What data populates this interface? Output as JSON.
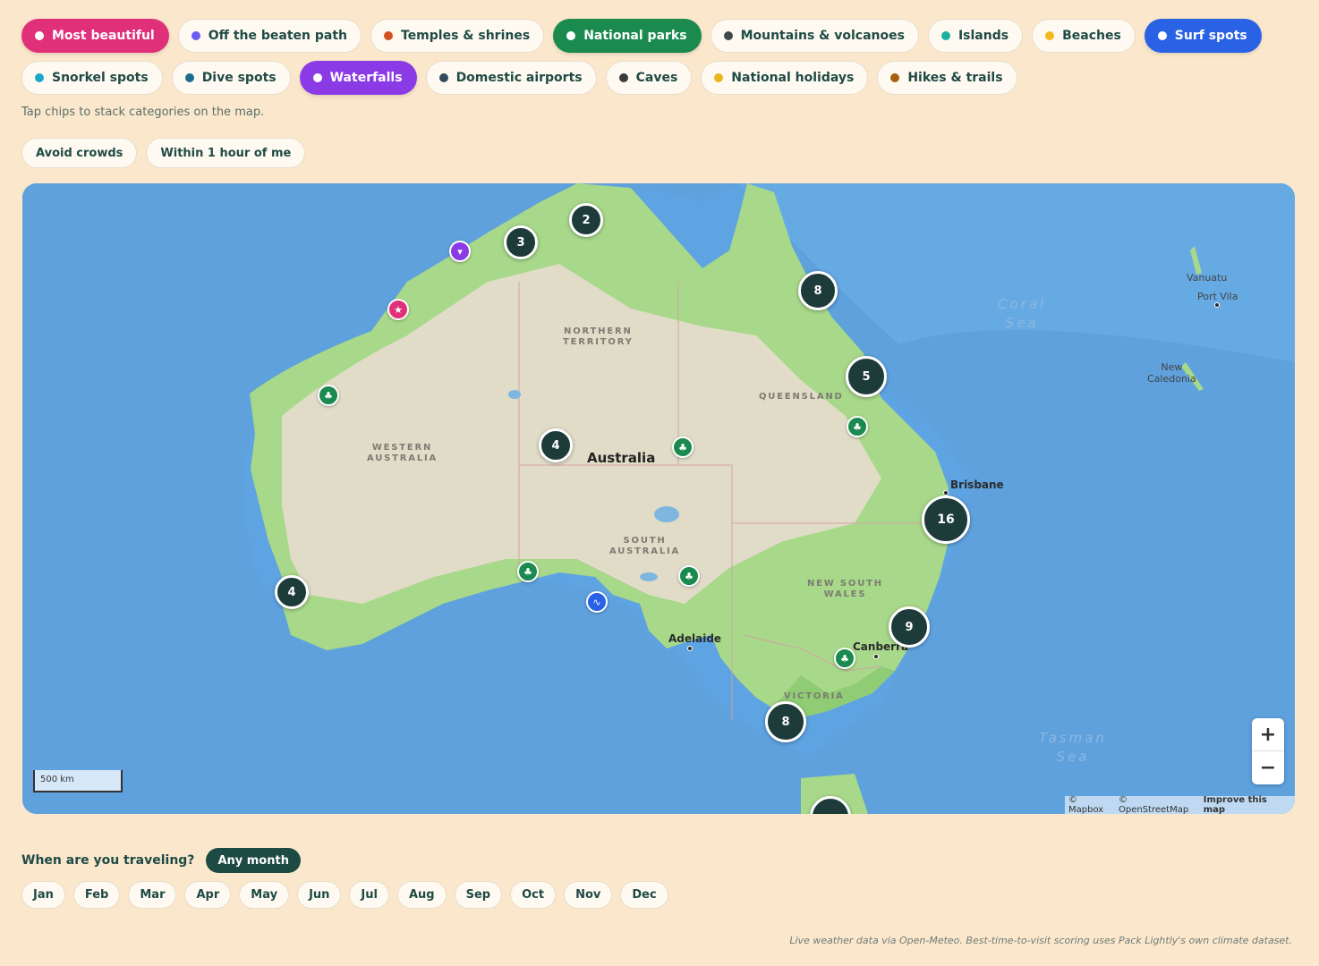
{
  "categories_row1": [
    {
      "label": "Most beautiful",
      "color": "#e0307a",
      "active": true
    },
    {
      "label": "Off the beaten path",
      "color": "#6a5cf0",
      "active": false
    },
    {
      "label": "Temples & shrines",
      "color": "#d4501f",
      "active": false
    },
    {
      "label": "National parks",
      "color": "#1a8a4f",
      "active": true
    },
    {
      "label": "Mountains & volcanoes",
      "color": "#3d4a48",
      "active": false
    },
    {
      "label": "Islands",
      "color": "#1ab0a0",
      "active": false
    },
    {
      "label": "Beaches",
      "color": "#f2b81e",
      "active": false
    },
    {
      "label": "Surf spots",
      "color": "#2a62e6",
      "active": true
    }
  ],
  "categories_row2": [
    {
      "label": "Snorkel spots",
      "color": "#1aa8c8",
      "active": false
    },
    {
      "label": "Dive spots",
      "color": "#1a6e8c",
      "active": false
    },
    {
      "label": "Waterfalls",
      "color": "#8a3be6",
      "active": true
    },
    {
      "label": "Domestic airports",
      "color": "#344a5c",
      "active": false
    },
    {
      "label": "Caves",
      "color": "#3a3a3a",
      "active": false
    },
    {
      "label": "National holidays",
      "color": "#e8b51a",
      "active": false
    },
    {
      "label": "Hikes & trails",
      "color": "#a8600f",
      "active": false
    }
  ],
  "hint": "Tap chips to stack categories on the map.",
  "filters": [
    "Avoid crowds",
    "Within 1 hour of me"
  ],
  "map": {
    "country_label": "Australia",
    "states": [
      {
        "name": "NORTHERN TERRITORY",
        "l1": "NORTHERN",
        "l2": "TERRITORY"
      },
      {
        "name": "QUEENSLAND",
        "l1": "QUEENSLAND",
        "l2": ""
      },
      {
        "name": "WESTERN AUSTRALIA",
        "l1": "WESTERN",
        "l2": "AUSTRALIA"
      },
      {
        "name": "SOUTH AUSTRALIA",
        "l1": "SOUTH",
        "l2": "AUSTRALIA"
      },
      {
        "name": "NEW SOUTH WALES",
        "l1": "NEW SOUTH",
        "l2": "WALES"
      },
      {
        "name": "VICTORIA",
        "l1": "VICTORIA",
        "l2": ""
      }
    ],
    "seas": [
      {
        "l1": "Coral",
        "l2": "Sea"
      },
      {
        "l1": "Tasman",
        "l2": "Sea"
      }
    ],
    "cities": [
      "Brisbane",
      "Adelaide",
      "Canberra",
      "Port Vila"
    ],
    "places": [
      {
        "l1": "Vanuatu",
        "l2": ""
      },
      {
        "l1": "New",
        "l2": "Caledonia"
      }
    ],
    "clusters": [
      2,
      3,
      8,
      5,
      4,
      16,
      4,
      9,
      8,
      ""
    ],
    "pins": [
      {
        "category": "Waterfalls",
        "icon": "waterfall-icon",
        "glyph": "▾",
        "color": "#8a3be6"
      },
      {
        "category": "Most beautiful",
        "icon": "star-icon",
        "glyph": "★",
        "color": "#e0307a"
      },
      {
        "category": "National parks",
        "icon": "tree-icon",
        "glyph": "♣",
        "color": "#1a8a4f"
      },
      {
        "category": "National parks",
        "icon": "tree-icon",
        "glyph": "♣",
        "color": "#1a8a4f"
      },
      {
        "category": "National parks",
        "icon": "tree-icon",
        "glyph": "♣",
        "color": "#1a8a4f"
      },
      {
        "category": "National parks",
        "icon": "tree-icon",
        "glyph": "♣",
        "color": "#1a8a4f"
      },
      {
        "category": "National parks",
        "icon": "tree-icon",
        "glyph": "♣",
        "color": "#1a8a4f"
      },
      {
        "category": "Surf spots",
        "icon": "wave-icon",
        "glyph": "∿",
        "color": "#2a62e6"
      },
      {
        "category": "National parks",
        "icon": "tree-icon",
        "glyph": "♣",
        "color": "#1a8a4f"
      }
    ],
    "scale": "500 km",
    "attribution": [
      "© Mapbox",
      "© OpenStreetMap",
      "Improve this map"
    ],
    "zoom_in": "+",
    "zoom_out": "−"
  },
  "travel": {
    "label": "When are you traveling?",
    "any_month": "Any month",
    "months": [
      "Jan",
      "Feb",
      "Mar",
      "Apr",
      "May",
      "Jun",
      "Jul",
      "Aug",
      "Sep",
      "Oct",
      "Nov",
      "Dec"
    ]
  },
  "footer": "Live weather data via Open-Meteo. Best-time-to-visit scoring uses Pack Lightly's own climate dataset."
}
